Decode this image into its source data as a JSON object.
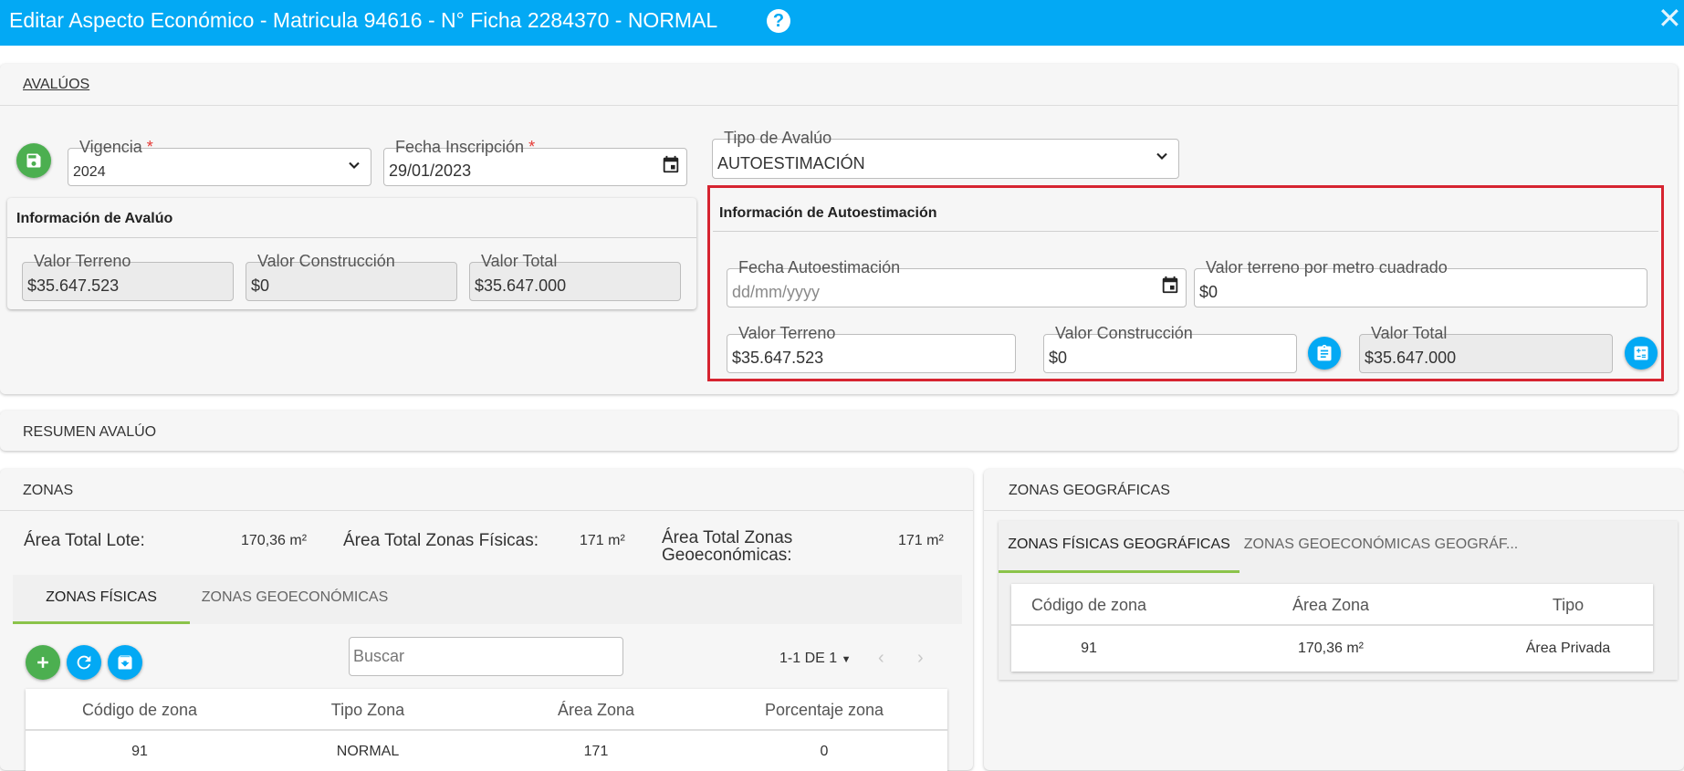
{
  "header": {
    "title": "Editar Aspecto Económico - Matricula 94616 - N° Ficha 2284370 - NORMAL",
    "help_icon": "help-circle-icon",
    "close_icon": "close-icon"
  },
  "avaluos": {
    "section_title": "AVALÚOS",
    "vigencia": {
      "label": "Vigencia",
      "required": "*",
      "value": "2024"
    },
    "fecha_inscripcion": {
      "label": "Fecha Inscripción",
      "required": "*",
      "value": "29/01/2023"
    },
    "tipo_avaluo": {
      "label": "Tipo de Avalúo",
      "value": "AUTOESTIMACIÓN"
    },
    "info_avaluo": {
      "title": "Información de Avalúo",
      "valor_terreno": {
        "label": "Valor Terreno",
        "value": "$35.647.523"
      },
      "valor_construccion": {
        "label": "Valor Construcción",
        "value": "$0"
      },
      "valor_total": {
        "label": "Valor Total",
        "value": "$35.647.000"
      }
    },
    "info_autoestimacion": {
      "title": "Información de Autoestimación",
      "fecha": {
        "label": "Fecha Autoestimación",
        "placeholder": "dd/mm/yyyy"
      },
      "valor_m2": {
        "label": "Valor terreno por metro cuadrado",
        "value": "$0"
      },
      "valor_terreno": {
        "label": "Valor Terreno",
        "value": "$35.647.523"
      },
      "valor_construccion": {
        "label": "Valor Construcción",
        "value": "$0"
      },
      "valor_total": {
        "label": "Valor Total",
        "value": "$35.647.000"
      }
    }
  },
  "resumen": {
    "section_title": "RESUMEN AVALÚO"
  },
  "zonas": {
    "section_title": "ZONAS",
    "area_lote": {
      "label": "Área Total Lote:",
      "value": "170,36 m²"
    },
    "area_fisicas": {
      "label": "Área Total Zonas Físicas:",
      "value": "171 m²"
    },
    "area_geo": {
      "label_line1": "Área Total Zonas",
      "label_line2": "Geoeconómicas:",
      "value": "171 m²"
    },
    "tabs": [
      "ZONAS FÍSICAS",
      "ZONAS GEOECONÓMICAS"
    ],
    "search_placeholder": "Buscar",
    "pagination": "1-1 DE 1",
    "columns": [
      "Código de zona",
      "Tipo Zona",
      "Área Zona",
      "Porcentaje zona"
    ],
    "rows": [
      [
        "91",
        "NORMAL",
        "171",
        "0"
      ]
    ]
  },
  "zonas_geo": {
    "section_title": "ZONAS GEOGRÁFICAS",
    "tabs": [
      "ZONAS FÍSICAS GEOGRÁFICAS",
      "ZONAS GEOECONÓMICAS GEOGRÁF..."
    ],
    "columns": [
      "Código de zona",
      "Área Zona",
      "Tipo"
    ],
    "rows": [
      [
        "91",
        "170,36 m²",
        "Área Privada"
      ]
    ]
  },
  "colors": {
    "header": "#03a9f4",
    "accent_green": "#4caf50",
    "highlight_red": "#d62430",
    "tab_underline": "#8bc34a"
  }
}
